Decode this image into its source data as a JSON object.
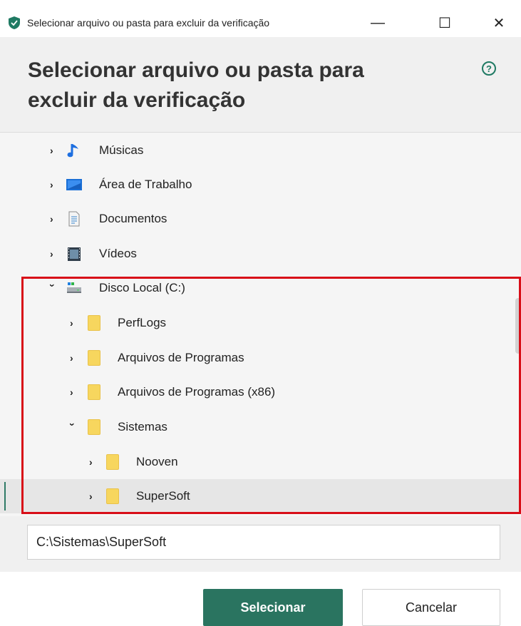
{
  "window": {
    "title": "Selecionar arquivo ou pasta para excluir da verificação",
    "minimize_glyph": "—",
    "maximize_glyph": "☐",
    "close_glyph": "✕"
  },
  "header": {
    "title": "Selecionar arquivo ou pasta para excluir da verificação",
    "help_glyph": "?"
  },
  "tree": {
    "items": [
      {
        "label": "Músicas",
        "icon": "music-note-icon",
        "expanded": false
      },
      {
        "label": "Área de Trabalho",
        "icon": "desktop-icon",
        "expanded": false
      },
      {
        "label": "Documentos",
        "icon": "document-icon",
        "expanded": false
      },
      {
        "label": "Vídeos",
        "icon": "video-icon",
        "expanded": false
      },
      {
        "label": "Disco Local (C:)",
        "icon": "drive-icon",
        "expanded": true
      },
      {
        "label": "PerfLogs",
        "icon": "folder-icon",
        "expanded": false
      },
      {
        "label": "Arquivos de Programas",
        "icon": "folder-icon",
        "expanded": false
      },
      {
        "label": "Arquivos de Programas (x86)",
        "icon": "folder-icon",
        "expanded": false
      },
      {
        "label": "Sistemas",
        "icon": "folder-icon",
        "expanded": true
      },
      {
        "label": "Nooven",
        "icon": "folder-icon",
        "expanded": false
      },
      {
        "label": "SuperSoft",
        "icon": "folder-icon",
        "expanded": false,
        "selected": true
      }
    ]
  },
  "path": {
    "value": "C:\\Sistemas\\SuperSoft"
  },
  "buttons": {
    "select_label": "Selecionar",
    "cancel_label": "Cancelar"
  },
  "colors": {
    "accent": "#2a7460",
    "highlight_border": "#d80e18",
    "folder": "#f7d65e"
  }
}
